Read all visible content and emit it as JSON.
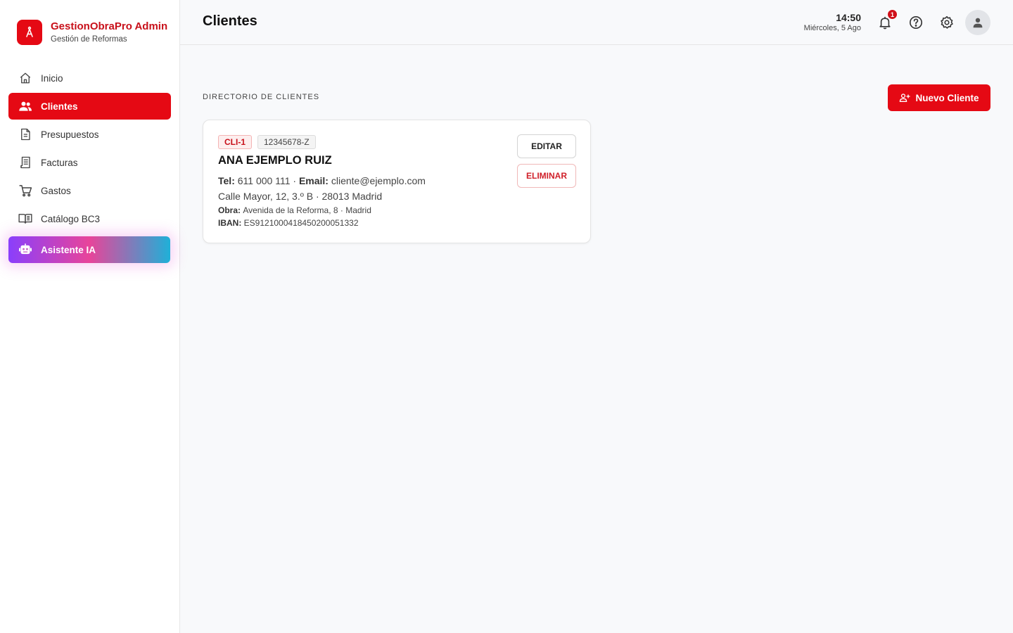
{
  "brand": {
    "title": "GestionObraPro Admin",
    "subtitle": "Gestión de Reformas",
    "accent": "#e50914"
  },
  "sidebar": {
    "items": [
      {
        "label": "Inicio",
        "icon": "home-icon",
        "active": false
      },
      {
        "label": "Clientes",
        "icon": "users-icon",
        "active": true
      },
      {
        "label": "Presupuestos",
        "icon": "document-icon",
        "active": false
      },
      {
        "label": "Facturas",
        "icon": "receipt-icon",
        "active": false
      },
      {
        "label": "Gastos",
        "icon": "cart-icon",
        "active": false
      },
      {
        "label": "Catálogo BC3",
        "icon": "book-icon",
        "active": false
      }
    ],
    "ai": {
      "label": "Asistente IA",
      "icon": "robot-icon"
    }
  },
  "header": {
    "title": "Clientes",
    "time": "14:50",
    "date": "Miércoles, 5 Ago",
    "notifications_count": "1"
  },
  "main": {
    "section_label": "DIRECTORIO DE CLIENTES",
    "new_button": "Nuevo Cliente",
    "clients": [
      {
        "id": "CLI-1",
        "dni": "12345678-Z",
        "name": "ANA EJEMPLO RUIZ",
        "tel_label": "Tel:",
        "tel": "611 000 111",
        "email_label": "Email:",
        "email": "cliente@ejemplo.com",
        "address": "Calle Mayor, 12, 3.º B · 28013 Madrid",
        "obra_label": "Obra:",
        "obra": "Avenida de la Reforma, 8 · Madrid",
        "iban_label": "IBAN:",
        "iban": "ES9121000418450200051332",
        "edit_label": "EDITAR",
        "delete_label": "ELIMINAR"
      }
    ]
  }
}
